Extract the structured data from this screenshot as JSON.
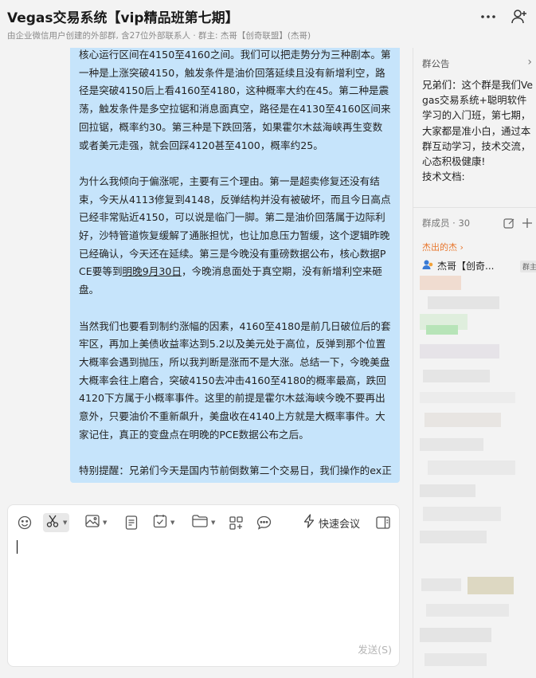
{
  "header": {
    "title": "Vegas交易系统【vip精品班第七期】",
    "subtitle": "由企业微信用户创建的外部群, 含27位外部联系人 · 群主: 杰哥【创奇联盟】(杰哥)"
  },
  "message": {
    "paragraphs": [
      "核心运行区间在4150至4160之间。我们可以把走势分为三种剧本。第一种是上涨突破4150，触发条件是油价回落延续且没有新增利空，路径是突破4150后上看4160至4180，这种概率大约在45。第二种是震荡，触发条件是多空拉锯和消息面真空，路径是在4130至4160区间来回拉锯，概率约30。第三种是下跌回落，如果霍尔木兹海峡再生变数或者美元走强，就会回踩4120甚至4100，概率约25。",
      "为什么我倾向于偏涨呢，主要有三个理由。第一是超卖修复还没有结束，今天从4113修复到4148，反弹结构并没有被破坏，而且今日高点已经非常贴近4150，可以说是临门一脚。第二是油价回落属于边际利好，沙特管道恢复缓解了通胀担忧，也让加息压力暂缓，这个逻辑昨晚已经确认，今天还在延续。第三是今晚没有重磅数据公布，核心数据PCE要等到",
      "当然我们也要看到制约涨幅的因素，4160至4180是前几日破位后的套牢区，再加上美债收益率达到5.2以及美元处于高位，反弹到那个位置大概率会遇到抛压，所以我判断是涨而不是大涨。总结一下，今晚美盘大概率会往上磨合，突破4150去冲击4160至4180的概率最高，跌回4120下方属于小概率事件。这里的前提是霍尔木兹海峡今晚不要再出意外，只要油价不重新飙升，美盘收在4140上方就是大概率事件。大家记住，真正的变盘点在明晚的PCE数据公布之后。",
      "特别提醒：兄弟们今天是国内节前倒数第二个交易日，我们操作的ex正常节假日休息，不受国内节假日影响！"
    ],
    "date_link": "明晚9月30日",
    "after_link": "，今晚消息面处于真空期，没有新增利空来砸盘。"
  },
  "composer": {
    "meeting_label": "快速会议",
    "send_label": "发送(S)"
  },
  "panel": {
    "notice_title": "群公告",
    "notice_body": "兄弟们：这个群是我们Vegas交易系统+聪明软件学习的入门班，第七期，大家都是准小白，通过本群互动学习，技术交流，心态积极健康!",
    "notice_more": "技术文档:",
    "members_title": "群成员 · 30",
    "starred_label": "杰出的杰 ›",
    "owner_name": "杰哥【创奇...",
    "owner_badge": "群主"
  },
  "colors": {
    "bubble": "#c6e4fb",
    "accent_orange": "#e8772e",
    "background": "#f3f3f3"
  },
  "icons": [
    "more-icon",
    "add-member-icon",
    "emoji-icon",
    "scissors-icon",
    "image-icon",
    "document-icon",
    "schedule-icon",
    "folder-icon",
    "app-grid-icon",
    "chat-bubble-icon",
    "lightning-icon",
    "side-panel-icon",
    "edit-icon",
    "add-icon",
    "chevron-right-icon",
    "user-icon"
  ]
}
